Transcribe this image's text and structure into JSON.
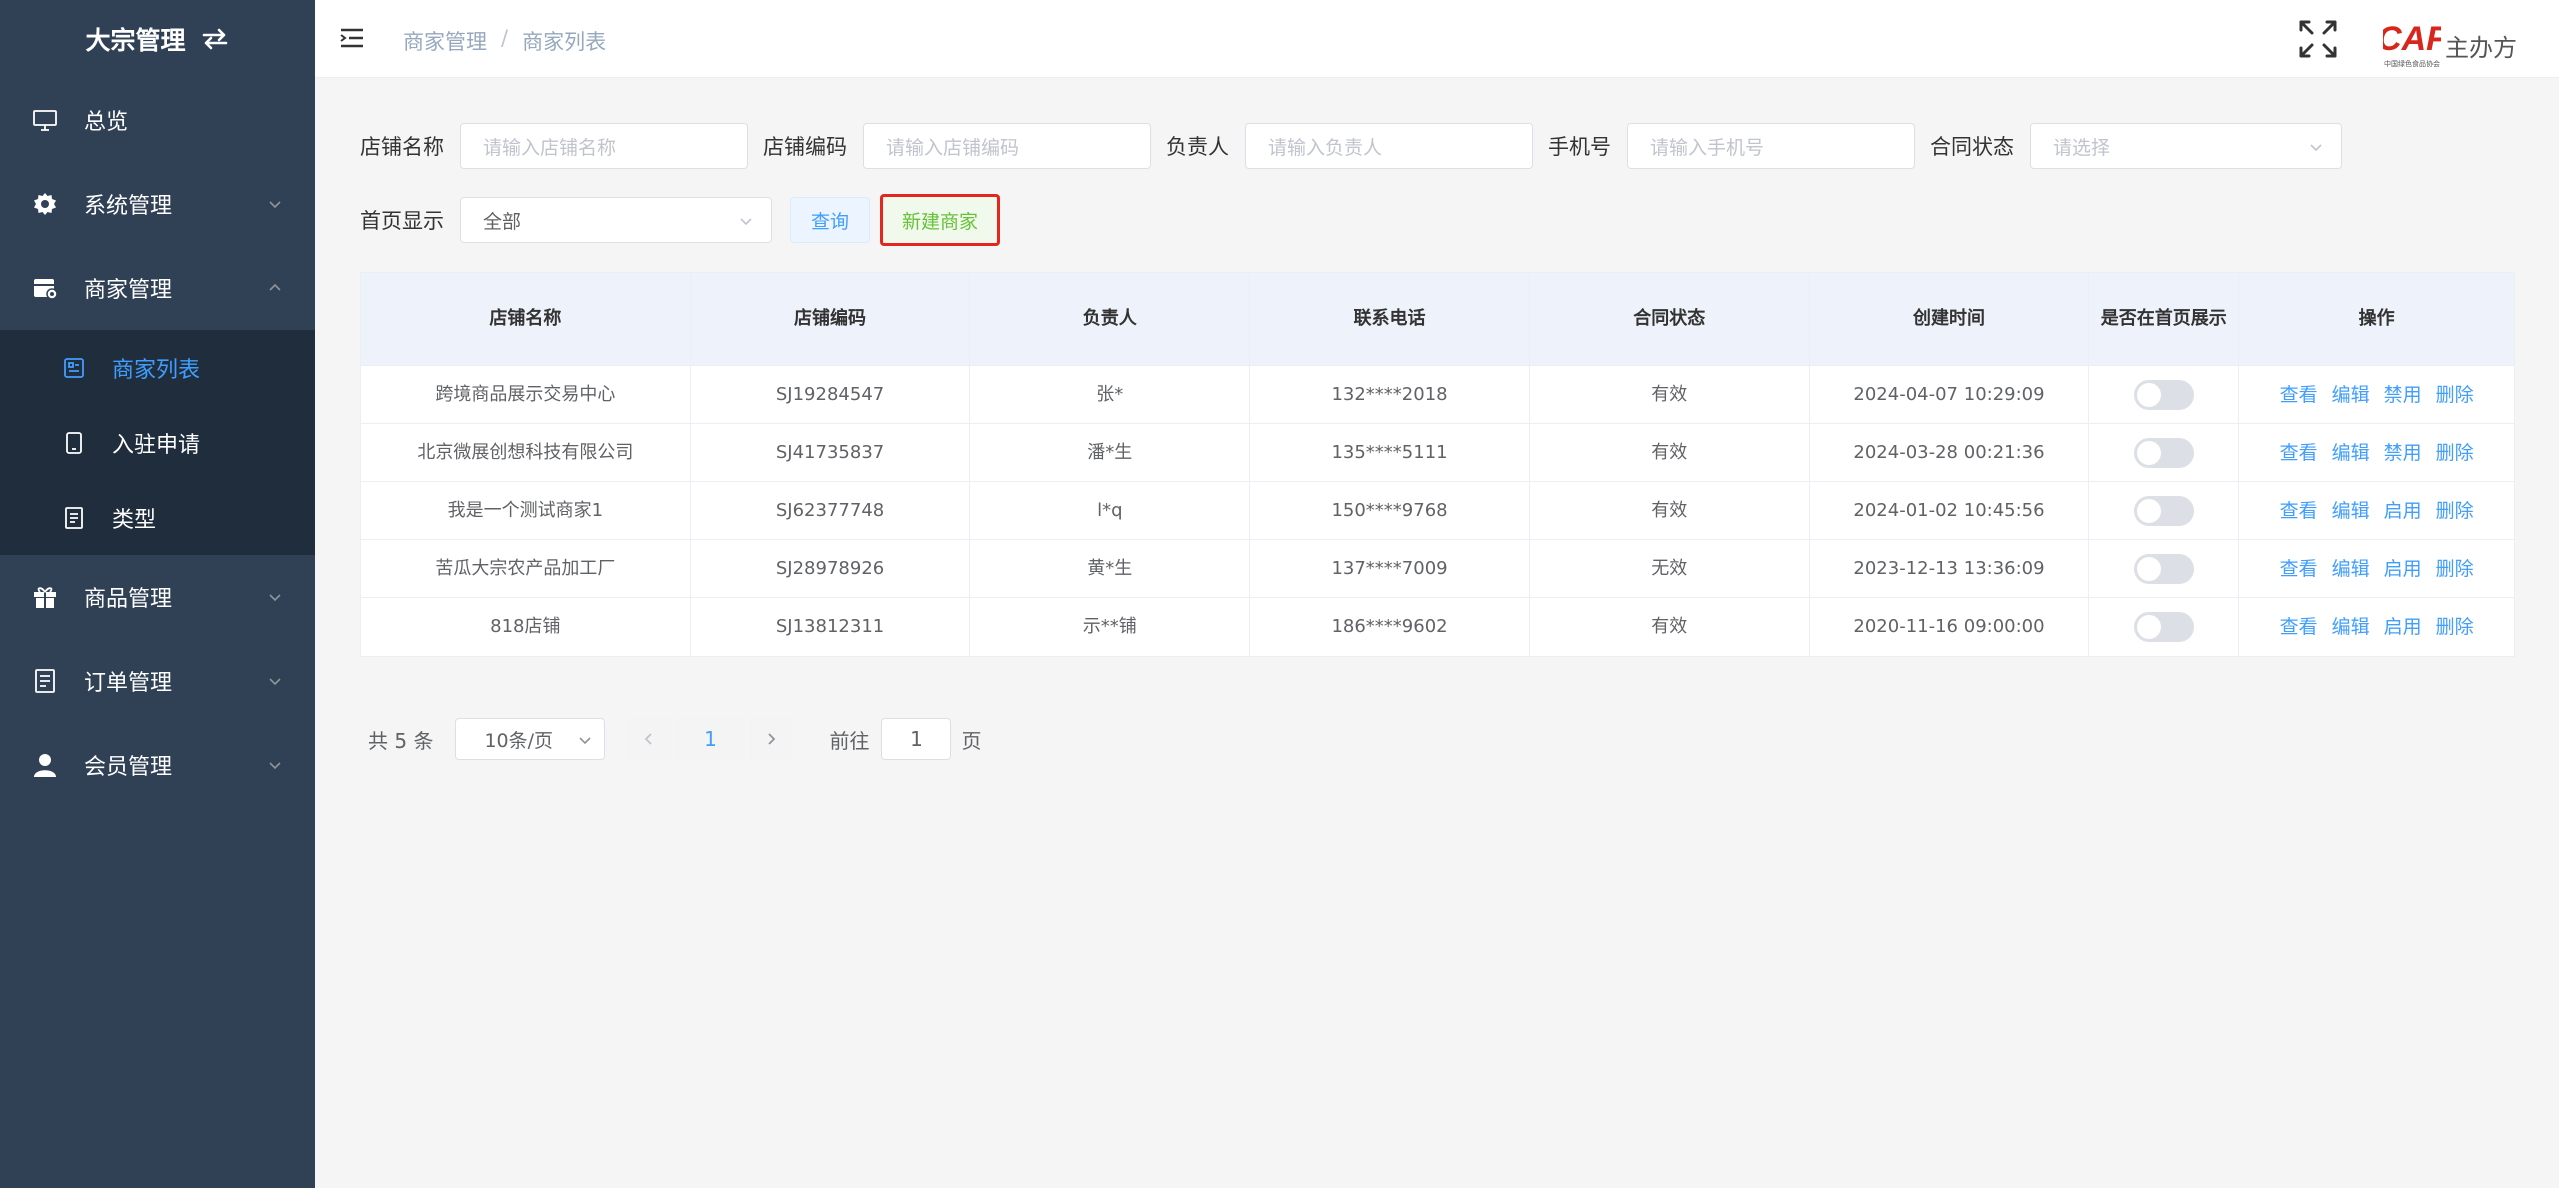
{
  "app": {
    "title": "大宗管理"
  },
  "sidebar": {
    "items": [
      {
        "label": "总览",
        "icon": "monitor-icon"
      },
      {
        "label": "系统管理",
        "icon": "gear-icon"
      },
      {
        "label": "商家管理",
        "icon": "store-icon",
        "expanded": true,
        "children": [
          {
            "label": "商家列表",
            "icon": "list-icon",
            "active": true
          },
          {
            "label": "入驻申请",
            "icon": "tablet-icon"
          },
          {
            "label": "类型",
            "icon": "document-icon"
          }
        ]
      },
      {
        "label": "商品管理",
        "icon": "gift-icon"
      },
      {
        "label": "订单管理",
        "icon": "order-icon"
      },
      {
        "label": "会员管理",
        "icon": "user-icon"
      }
    ]
  },
  "header": {
    "breadcrumb": [
      "商家管理",
      "商家列表"
    ],
    "breadcrumb_sep": "/",
    "logo_text": "CAF",
    "logo_subtext": "中国绿色食品协会",
    "host_label": "主办方"
  },
  "filters": {
    "store_name": {
      "label": "店铺名称",
      "placeholder": "请输入店铺名称"
    },
    "store_code": {
      "label": "店铺编码",
      "placeholder": "请输入店铺编码"
    },
    "owner": {
      "label": "负责人",
      "placeholder": "请输入负责人"
    },
    "phone": {
      "label": "手机号",
      "placeholder": "请输入手机号"
    },
    "contract_status": {
      "label": "合同状态",
      "placeholder": "请选择"
    },
    "homepage_display": {
      "label": "首页显示",
      "value": "全部"
    },
    "query_button": "查询",
    "new_button": "新建商家"
  },
  "table": {
    "columns": [
      "店铺名称",
      "店铺编码",
      "负责人",
      "联系电话",
      "合同状态",
      "创建时间",
      "是否在首页展示",
      "操作"
    ],
    "rows": [
      {
        "name": "跨境商品展示交易中心",
        "code": "SJ19284547",
        "owner": "张*",
        "phone": "132****2018",
        "status": "有效",
        "created": "2024-04-07 10:29:09",
        "on_home": false,
        "ops": [
          "查看",
          "编辑",
          "禁用",
          "删除"
        ]
      },
      {
        "name": "北京微展创想科技有限公司",
        "code": "SJ41735837",
        "owner": "潘*生",
        "phone": "135****5111",
        "status": "有效",
        "created": "2024-03-28 00:21:36",
        "on_home": false,
        "ops": [
          "查看",
          "编辑",
          "禁用",
          "删除"
        ]
      },
      {
        "name": "我是一个测试商家1",
        "code": "SJ62377748",
        "owner": "l*q",
        "phone": "150****9768",
        "status": "有效",
        "created": "2024-01-02 10:45:56",
        "on_home": false,
        "ops": [
          "查看",
          "编辑",
          "启用",
          "删除"
        ]
      },
      {
        "name": "苦瓜大宗农产品加工厂",
        "code": "SJ28978926",
        "owner": "黄*生",
        "phone": "137****7009",
        "status": "无效",
        "created": "2023-12-13 13:36:09",
        "on_home": false,
        "ops": [
          "查看",
          "编辑",
          "启用",
          "删除"
        ]
      },
      {
        "name": "818店铺",
        "code": "SJ13812311",
        "owner": "示**铺",
        "phone": "186****9602",
        "status": "有效",
        "created": "2020-11-16 09:00:00",
        "on_home": false,
        "ops": [
          "查看",
          "编辑",
          "启用",
          "删除"
        ]
      }
    ]
  },
  "pagination": {
    "total_text": "共 5 条",
    "page_size": "10条/页",
    "current_page": "1",
    "goto_prefix": "前往",
    "goto_value": "1",
    "goto_suffix": "页"
  },
  "colors": {
    "sidebar_bg": "#304156",
    "submenu_bg": "#1f2d3d",
    "accent": "#409eff",
    "success": "#67c23a",
    "highlight_border": "#e5261f"
  }
}
